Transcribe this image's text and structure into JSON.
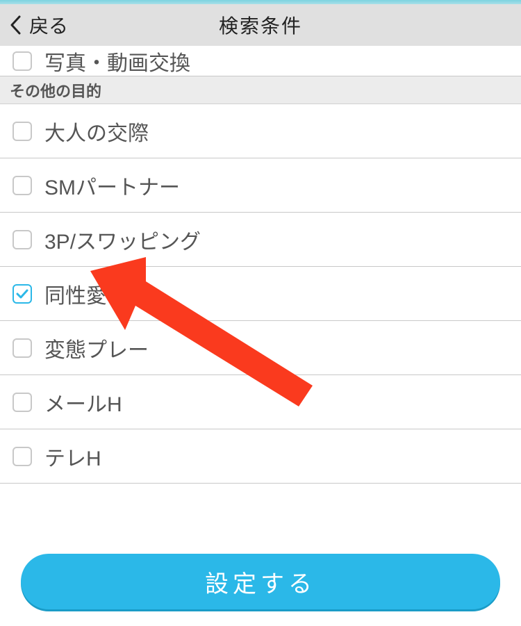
{
  "header": {
    "back_label": "戻る",
    "title": "検索条件"
  },
  "partial_item": {
    "label": "写真・動画交換",
    "checked": false
  },
  "section": {
    "title": "その他の目的",
    "items": [
      {
        "label": "大人の交際",
        "checked": false
      },
      {
        "label": "SMパートナー",
        "checked": false
      },
      {
        "label": "3P/スワッピング",
        "checked": false
      },
      {
        "label": "同性愛",
        "checked": true
      },
      {
        "label": "変態プレー",
        "checked": false
      },
      {
        "label": "メールH",
        "checked": false
      },
      {
        "label": "テレH",
        "checked": false
      }
    ]
  },
  "footer": {
    "button_label": "設定する"
  },
  "colors": {
    "accent": "#2bb8e8",
    "arrow": "#fa3a1e"
  }
}
